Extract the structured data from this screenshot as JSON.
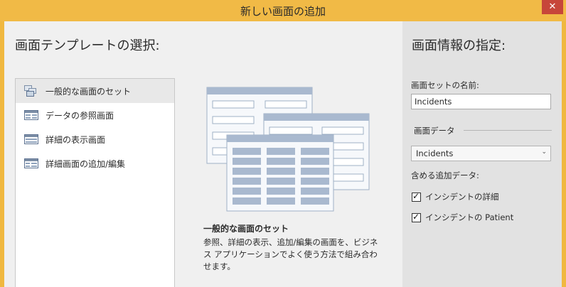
{
  "window": {
    "title": "新しい画面の追加",
    "close_label": "✕"
  },
  "left": {
    "heading": "画面テンプレートの選択:",
    "templates": [
      {
        "label": "一般的な画面のセット",
        "icon": "screen-set-icon",
        "selected": true
      },
      {
        "label": "データの参照画面",
        "icon": "browse-screen-icon",
        "selected": false
      },
      {
        "label": "詳細の表示画面",
        "icon": "details-screen-icon",
        "selected": false
      },
      {
        "label": "詳細画面の追加/編集",
        "icon": "add-edit-screen-icon",
        "selected": false
      }
    ],
    "description_title": "一般的な画面のセット",
    "description_text": "参照、詳細の表示、追加/編集の画面を、ビジネス アプリケーションでよく使う方法で組み合わせます。"
  },
  "right": {
    "heading": "画面情報の指定:",
    "screen_set_name_label": "画面セットの名前:",
    "screen_set_name_value": "Incidents",
    "screen_data_label": "画面データ",
    "screen_data_selected": "Incidents",
    "additional_data_label": "含める追加データ:",
    "additional_data_options": [
      {
        "label": "インシデントの詳細",
        "checked": true
      },
      {
        "label": "インシデントの Patient",
        "checked": true
      }
    ]
  },
  "colors": {
    "title_bar": "#f1ba46",
    "close_button": "#c7463a",
    "selected_item": "#e8e8e8"
  }
}
